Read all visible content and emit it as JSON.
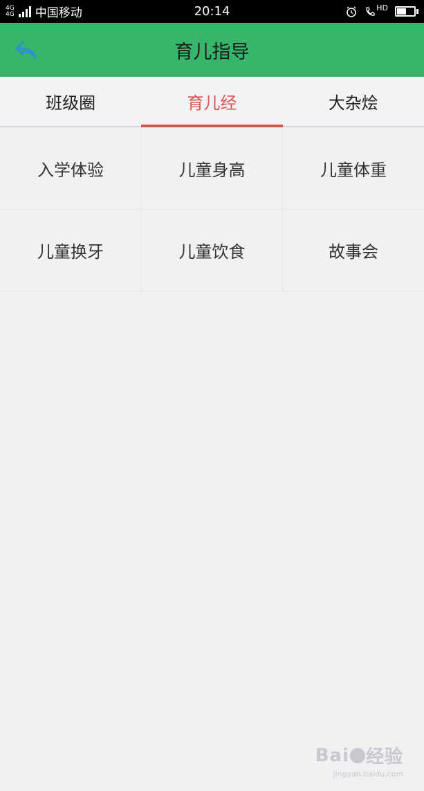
{
  "status_bar": {
    "network": "4G",
    "carrier": "中国移动",
    "time": "20:14",
    "hd_label": "HD"
  },
  "header": {
    "title": "育儿指导",
    "back_icon": "back-arrow-icon",
    "background_color": "#37b56a"
  },
  "tabs": [
    {
      "label": "班级圈",
      "active": false
    },
    {
      "label": "育儿经",
      "active": true
    },
    {
      "label": "大杂烩",
      "active": false
    }
  ],
  "accent_color": "#d9534f",
  "grid": {
    "items": [
      {
        "label": "入学体验"
      },
      {
        "label": "儿童身高"
      },
      {
        "label": "儿童体重"
      },
      {
        "label": "儿童换牙"
      },
      {
        "label": "儿童饮食"
      },
      {
        "label": "故事会"
      }
    ]
  },
  "watermark": {
    "brand": "Bai",
    "brand_tail": "经验",
    "url": "jingyan.baidu.com"
  }
}
